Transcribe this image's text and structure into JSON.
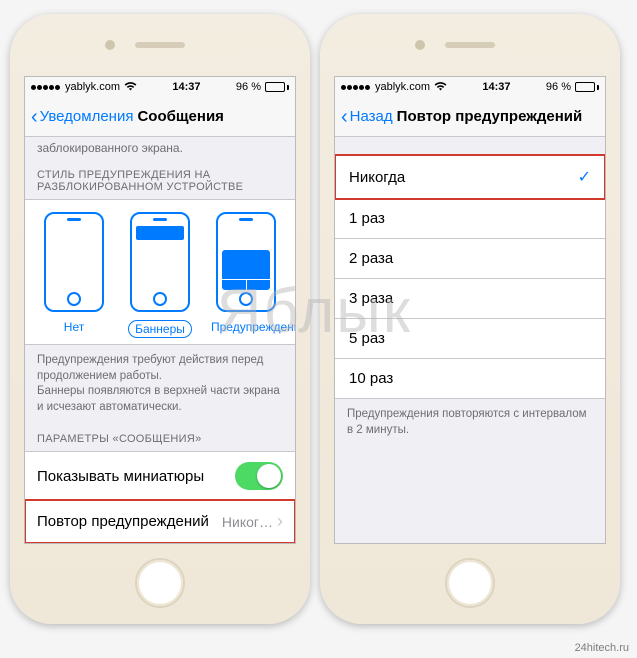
{
  "statusbar": {
    "carrier": "yablyk.com",
    "time": "14:37",
    "battery_pct": "96 %"
  },
  "left": {
    "back_label": "Уведомления",
    "title": "Сообщения",
    "truncated_top": "заблокированного экрана.",
    "section_style_header": "СТИЛЬ ПРЕДУПРЕЖДЕНИЯ НА РАЗБЛОКИРОВАННОМ УСТРОЙСТВЕ",
    "styles": {
      "none": "Нет",
      "banners": "Баннеры",
      "alerts": "Предупреждения"
    },
    "styles_footer": "Предупреждения требуют действия перед продолжением работы.\nБаннеры появляются в верхней части экрана и исчезают автоматически.",
    "section_params_header": "ПАРАМЕТРЫ «СООБЩЕНИЯ»",
    "thumbnails_label": "Показывать миниатюры",
    "repeat_label": "Повтор предупреждений",
    "repeat_value": "Никог…"
  },
  "right": {
    "back_label": "Назад",
    "title": "Повтор предупреждений",
    "options": [
      "Никогда",
      "1 раз",
      "2 раза",
      "3 раза",
      "5 раз",
      "10 раз"
    ],
    "selected_index": 0,
    "footer": "Предупреждения повторяются с интервалом в 2 минуты."
  },
  "watermark": "Яблык",
  "credit": "24hitech.ru"
}
